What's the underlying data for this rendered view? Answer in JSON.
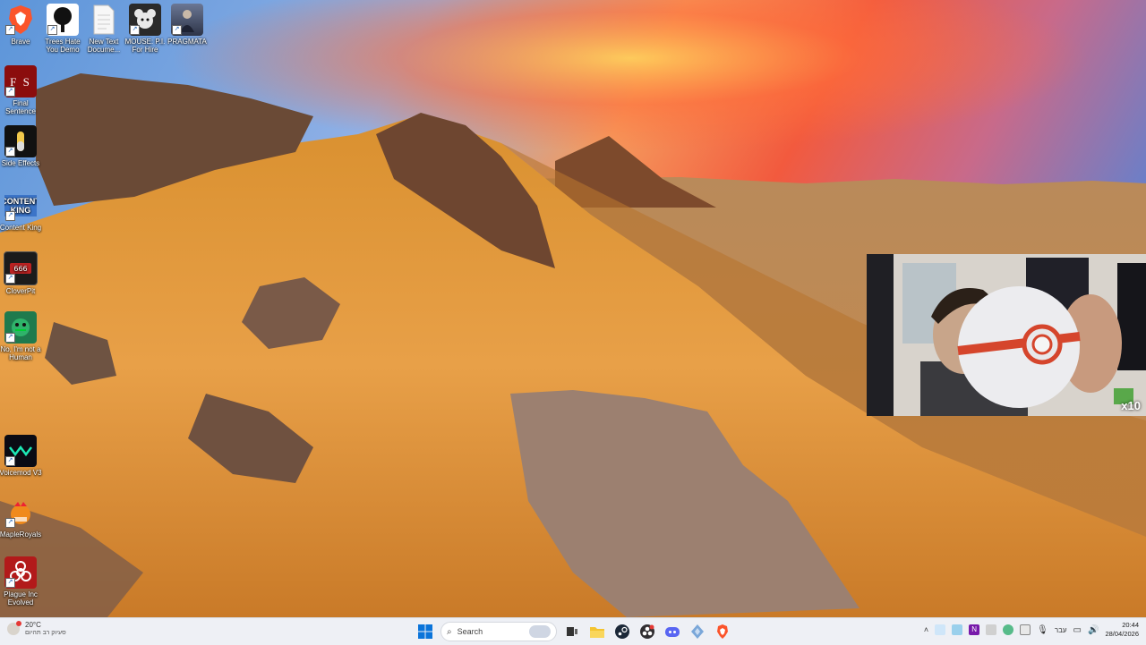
{
  "desktop": {
    "icons": [
      {
        "label": "Brave",
        "icon": "brave-icon",
        "color": "#fb542b"
      },
      {
        "label": "Trees Hate You Demo",
        "icon": "tree-icon",
        "color": "#ffffff"
      },
      {
        "label": "New Text Docume...",
        "icon": "text-document-icon",
        "color": "#f4f4f4"
      },
      {
        "label": "MOUSE: P.I. For Hire",
        "icon": "mouse-game-icon",
        "color": "#2a2a2a"
      },
      {
        "label": "PRAGMATA",
        "icon": "pragmata-icon",
        "color": "#4a5570"
      },
      {
        "label": "Final Sentence",
        "icon": "final-sentence-icon",
        "color": "#8b0d0d"
      },
      {
        "label": "Side Effects",
        "icon": "side-effects-icon",
        "color": "#111111"
      },
      {
        "label": "Content King",
        "icon": "content-king-icon",
        "color": "#3b74c8"
      },
      {
        "label": "CloverPit",
        "icon": "cloverpit-icon",
        "color": "#1b1b1b"
      },
      {
        "label": "No, I'm not a Human",
        "icon": "not-human-icon",
        "color": "#1f7a4d"
      },
      {
        "label": "Voicemod V3",
        "icon": "voicemod-icon",
        "color": "#0b0b14"
      },
      {
        "label": "MapleRoyals",
        "icon": "mapleroyals-icon",
        "color": "#f08a1c"
      },
      {
        "label": "Plague Inc Evolved",
        "icon": "biohazard-icon",
        "color": "#b21a1a"
      }
    ]
  },
  "webcam": {
    "badge": "x10"
  },
  "taskbar": {
    "weather_temp": "20°C",
    "weather_desc": "סעיוק רב תהיום",
    "search_placeholder": "Search",
    "apps": [
      {
        "icon": "windows-start-icon"
      },
      {
        "icon": "search-icon"
      },
      {
        "icon": "task-view-icon"
      },
      {
        "icon": "file-explorer-icon"
      },
      {
        "icon": "steam-icon"
      },
      {
        "icon": "obs-icon"
      },
      {
        "icon": "discord-icon"
      },
      {
        "icon": "app-icon"
      },
      {
        "icon": "brave-icon"
      }
    ],
    "tray_lang": "עבר",
    "time": "20:44",
    "date": "28/04/2026"
  }
}
